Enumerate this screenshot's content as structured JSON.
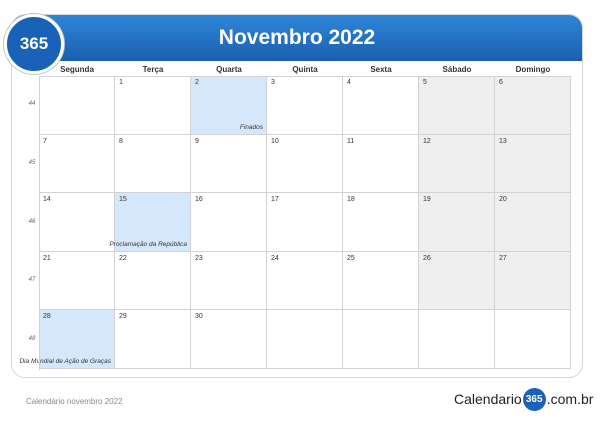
{
  "badge": "365",
  "title": "Novembro 2022",
  "days": [
    "Segunda",
    "Terça",
    "Quarta",
    "Quinta",
    "Sexta",
    "Sábado",
    "Domingo"
  ],
  "weeks": [
    {
      "num": "44",
      "cells": [
        "",
        "1",
        "2",
        "3",
        "4",
        "5",
        "6"
      ]
    },
    {
      "num": "45",
      "cells": [
        "7",
        "8",
        "9",
        "10",
        "11",
        "12",
        "13"
      ]
    },
    {
      "num": "46",
      "cells": [
        "14",
        "15",
        "16",
        "17",
        "18",
        "19",
        "20"
      ]
    },
    {
      "num": "47",
      "cells": [
        "21",
        "22",
        "23",
        "24",
        "25",
        "26",
        "27"
      ]
    },
    {
      "num": "48",
      "cells": [
        "28",
        "29",
        "30",
        "",
        "",
        "",
        ""
      ]
    }
  ],
  "holidays": {
    "finados": "Finados",
    "republica": "Proclamação da República",
    "consciencia": "Dia Mundial de Ação de Graças"
  },
  "footer": {
    "left": "Calendário novembro 2022",
    "logo_pre": "Calendario",
    "logo_circle": "365",
    "logo_post": ".com.br"
  }
}
